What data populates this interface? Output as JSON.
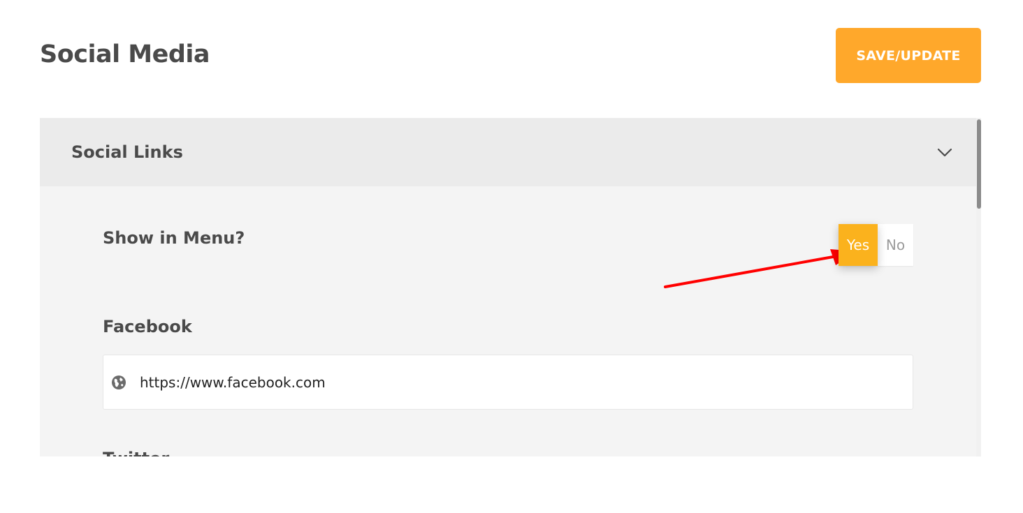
{
  "page": {
    "title": "Social Media",
    "save_label": "SAVE/UPDATE"
  },
  "section": {
    "title": "Social Links",
    "toggle_icon": "chevron-down-icon"
  },
  "show_in_menu": {
    "label": "Show in Menu?",
    "yes_label": "Yes",
    "no_label": "No",
    "selected": "Yes"
  },
  "facebook": {
    "label": "Facebook",
    "icon": "globe-icon",
    "value": "https://www.facebook.com"
  },
  "twitter": {
    "label": "Twitter"
  },
  "annotation": {
    "icon": "red-arrow",
    "color": "#ff0000"
  },
  "colors": {
    "accent": "#ffa82b",
    "toggle_active": "#fbb21d"
  }
}
